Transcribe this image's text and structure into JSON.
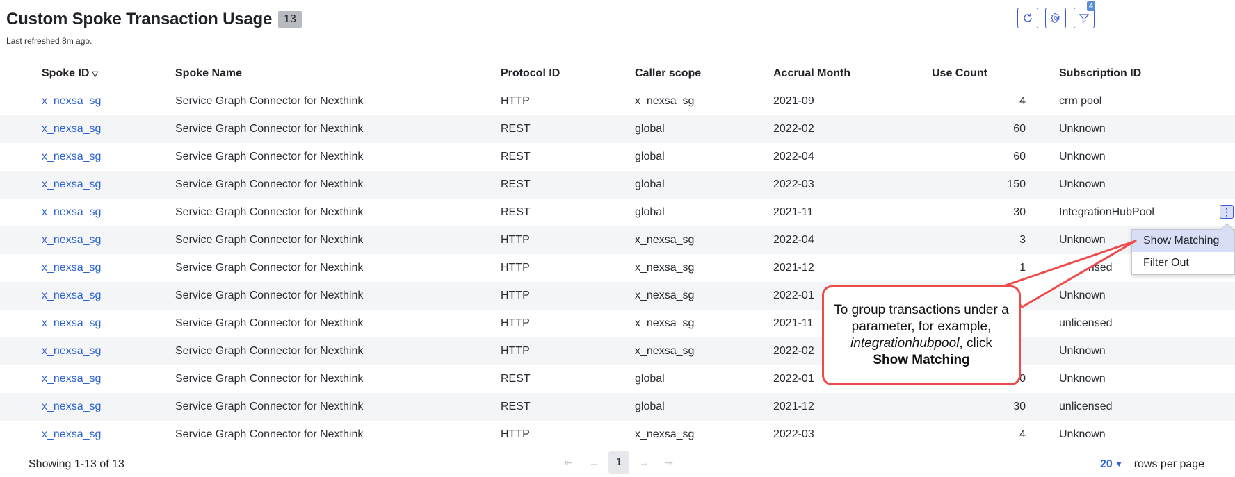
{
  "header": {
    "title": "Custom Spoke Transaction Usage",
    "count": "13",
    "last_refreshed": "Last refreshed 8m ago."
  },
  "toolbar": {
    "refresh_icon": "refresh-icon",
    "settings_icon": "gear-icon",
    "filter_icon": "filter-icon",
    "filter_count": "4"
  },
  "table": {
    "columns": [
      "Spoke ID",
      "Spoke Name",
      "Protocol ID",
      "Caller scope",
      "Accrual Month",
      "Use Count",
      "Subscription ID"
    ],
    "rows": [
      [
        "x_nexsa_sg",
        "Service Graph Connector for Nexthink",
        "HTTP",
        "x_nexsa_sg",
        "2021-09",
        "4",
        "crm pool"
      ],
      [
        "x_nexsa_sg",
        "Service Graph Connector for Nexthink",
        "REST",
        "global",
        "2022-02",
        "60",
        "Unknown"
      ],
      [
        "x_nexsa_sg",
        "Service Graph Connector for Nexthink",
        "REST",
        "global",
        "2022-04",
        "60",
        "Unknown"
      ],
      [
        "x_nexsa_sg",
        "Service Graph Connector for Nexthink",
        "REST",
        "global",
        "2022-03",
        "150",
        "Unknown"
      ],
      [
        "x_nexsa_sg",
        "Service Graph Connector for Nexthink",
        "REST",
        "global",
        "2021-11",
        "30",
        "IntegrationHubPool"
      ],
      [
        "x_nexsa_sg",
        "Service Graph Connector for Nexthink",
        "HTTP",
        "x_nexsa_sg",
        "2022-04",
        "3",
        "Unknown"
      ],
      [
        "x_nexsa_sg",
        "Service Graph Connector for Nexthink",
        "HTTP",
        "x_nexsa_sg",
        "2021-12",
        "1",
        "unlicensed"
      ],
      [
        "x_nexsa_sg",
        "Service Graph Connector for Nexthink",
        "HTTP",
        "x_nexsa_sg",
        "2022-01",
        "",
        "Unknown"
      ],
      [
        "x_nexsa_sg",
        "Service Graph Connector for Nexthink",
        "HTTP",
        "x_nexsa_sg",
        "2021-11",
        "",
        "unlicensed"
      ],
      [
        "x_nexsa_sg",
        "Service Graph Connector for Nexthink",
        "HTTP",
        "x_nexsa_sg",
        "2022-02",
        "",
        "Unknown"
      ],
      [
        "x_nexsa_sg",
        "Service Graph Connector for Nexthink",
        "REST",
        "global",
        "2022-01",
        "0",
        "Unknown"
      ],
      [
        "x_nexsa_sg",
        "Service Graph Connector for Nexthink",
        "REST",
        "global",
        "2021-12",
        "30",
        "unlicensed"
      ],
      [
        "x_nexsa_sg",
        "Service Graph Connector for Nexthink",
        "HTTP",
        "x_nexsa_sg",
        "2022-03",
        "4",
        "Unknown"
      ]
    ]
  },
  "context_menu": {
    "items": [
      "Show Matching",
      "Filter Out"
    ],
    "active": "Show Matching"
  },
  "callout": {
    "line1": "To group transactions under a parameter, for example,",
    "example": "integrationhubpool",
    "after_example": ", click",
    "action": "Show Matching"
  },
  "footer": {
    "showing": "Showing 1-13 of 13",
    "current_page": "1",
    "rows_per_page_value": "20",
    "rows_per_page_label": "rows per page"
  },
  "colors": {
    "accent": "#3b5bdb",
    "link": "#2d62d5",
    "callout_border": "#ef4b4b",
    "stripe": "#f4f5f7"
  }
}
